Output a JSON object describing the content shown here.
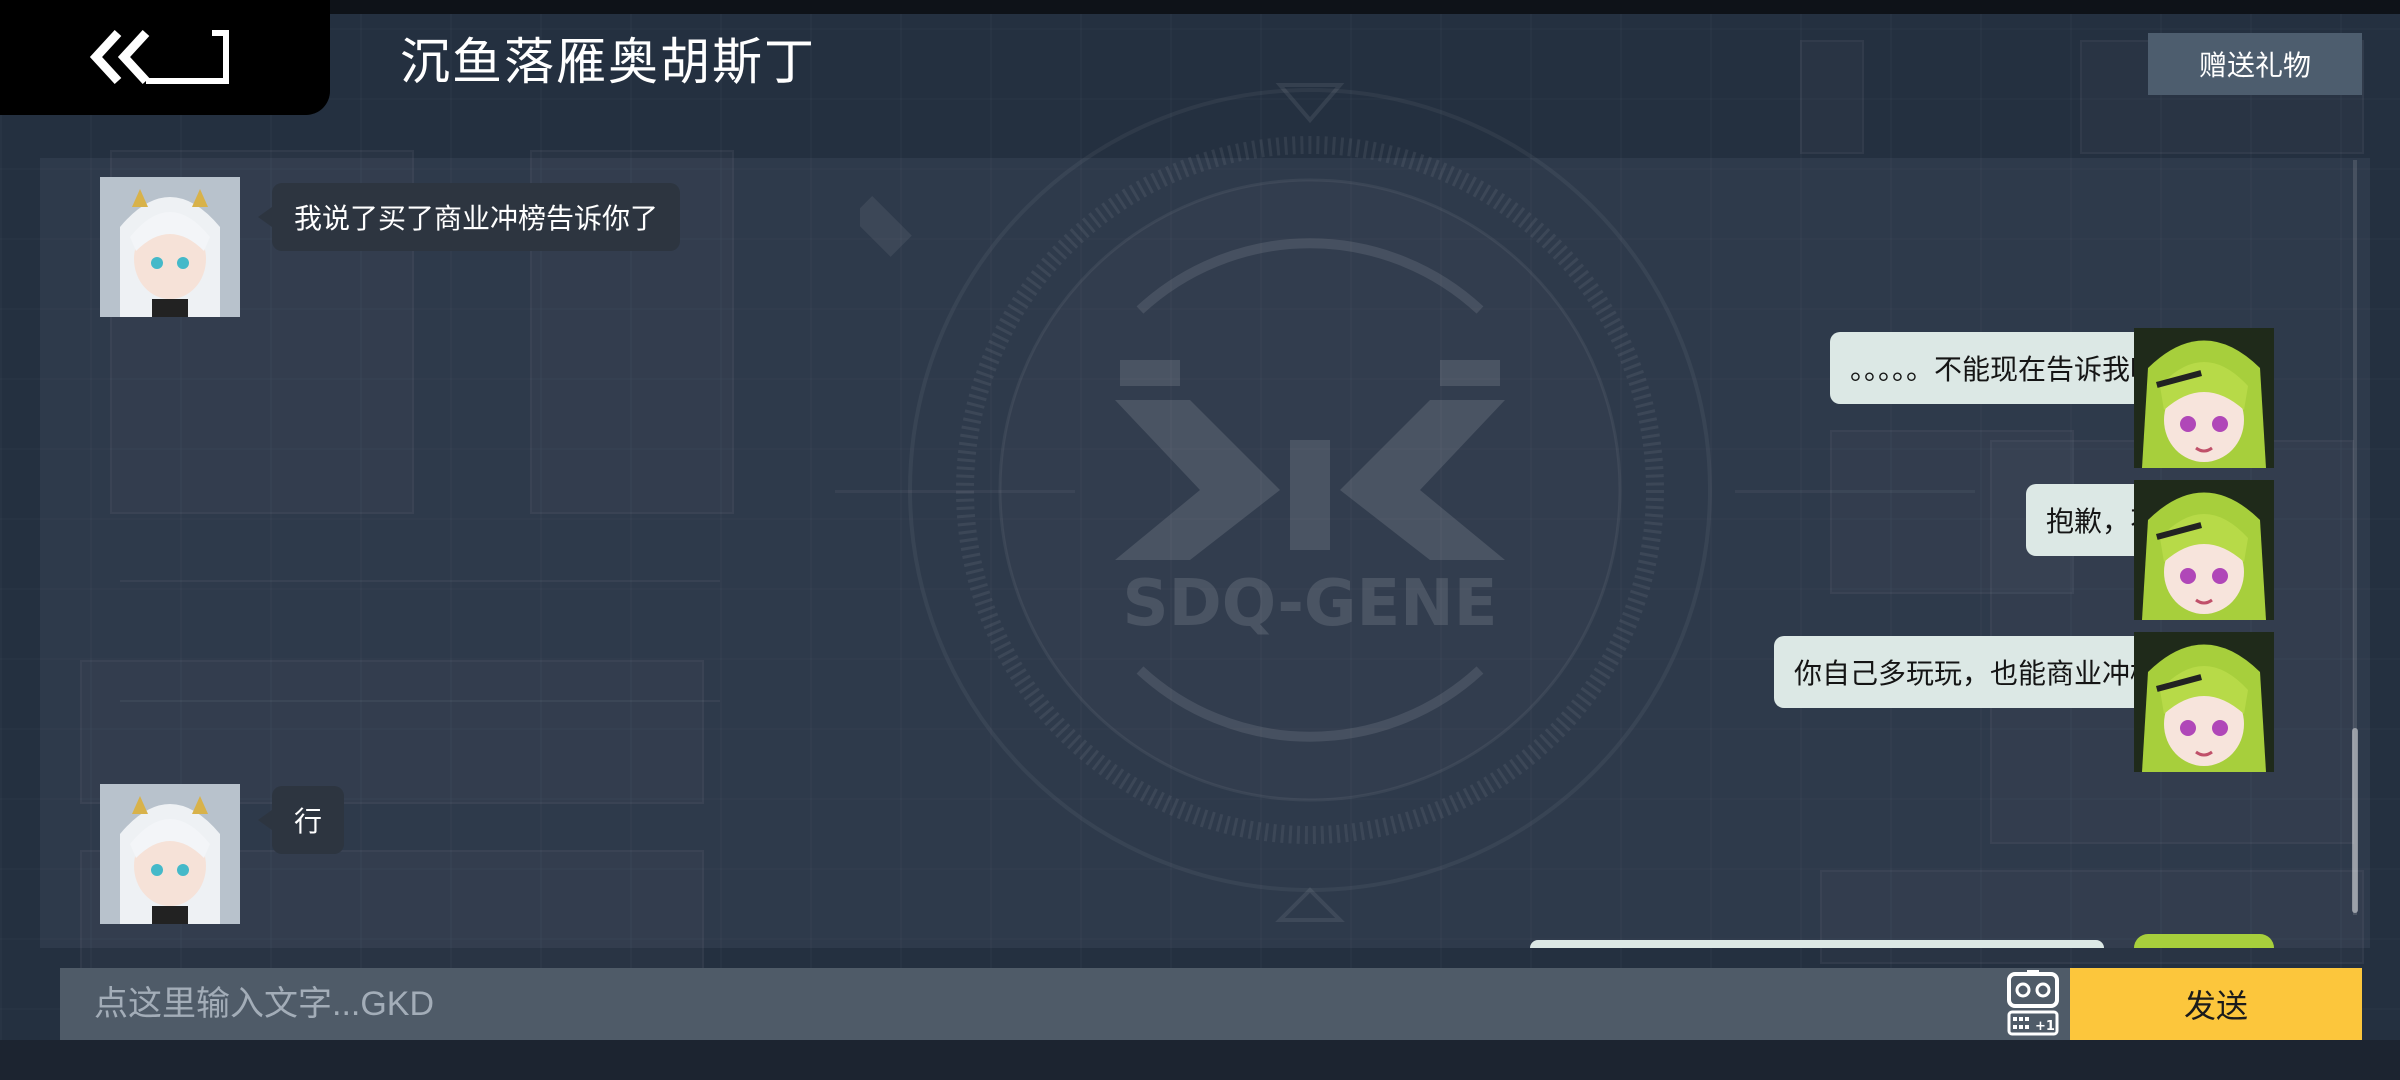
{
  "header": {
    "title": "沉鱼落雁奥胡斯丁",
    "back_icon": "double-chevron-back-icon",
    "gift_label": "赠送礼物"
  },
  "emblem": {
    "text": "SDQ-GENE"
  },
  "messages": [
    {
      "side": "left",
      "character": "white-haired-girl",
      "text": "我说了买了商业冲榜告诉你了"
    },
    {
      "side": "right",
      "character": "green-haired-girl",
      "text": "。。。。。不能现在告诉我吗？"
    },
    {
      "side": "right",
      "character": "green-haired-girl",
      "text": "抱歉，不卖"
    },
    {
      "side": "right",
      "character": "green-haired-girl",
      "text": "你自己多玩玩，也能商业冲榜的"
    },
    {
      "side": "left",
      "character": "white-haired-girl",
      "text": "行"
    }
  ],
  "input": {
    "placeholder": "点这里输入文字...GKD",
    "emoji_icon": "robot-emoji-icon",
    "emoji_badge": "+1",
    "send_label": "发送"
  },
  "colors": {
    "send_button": "#fcc63c",
    "bubble_right": "#dce8e5",
    "bubble_left": "#2d3540",
    "background": "#243040"
  }
}
